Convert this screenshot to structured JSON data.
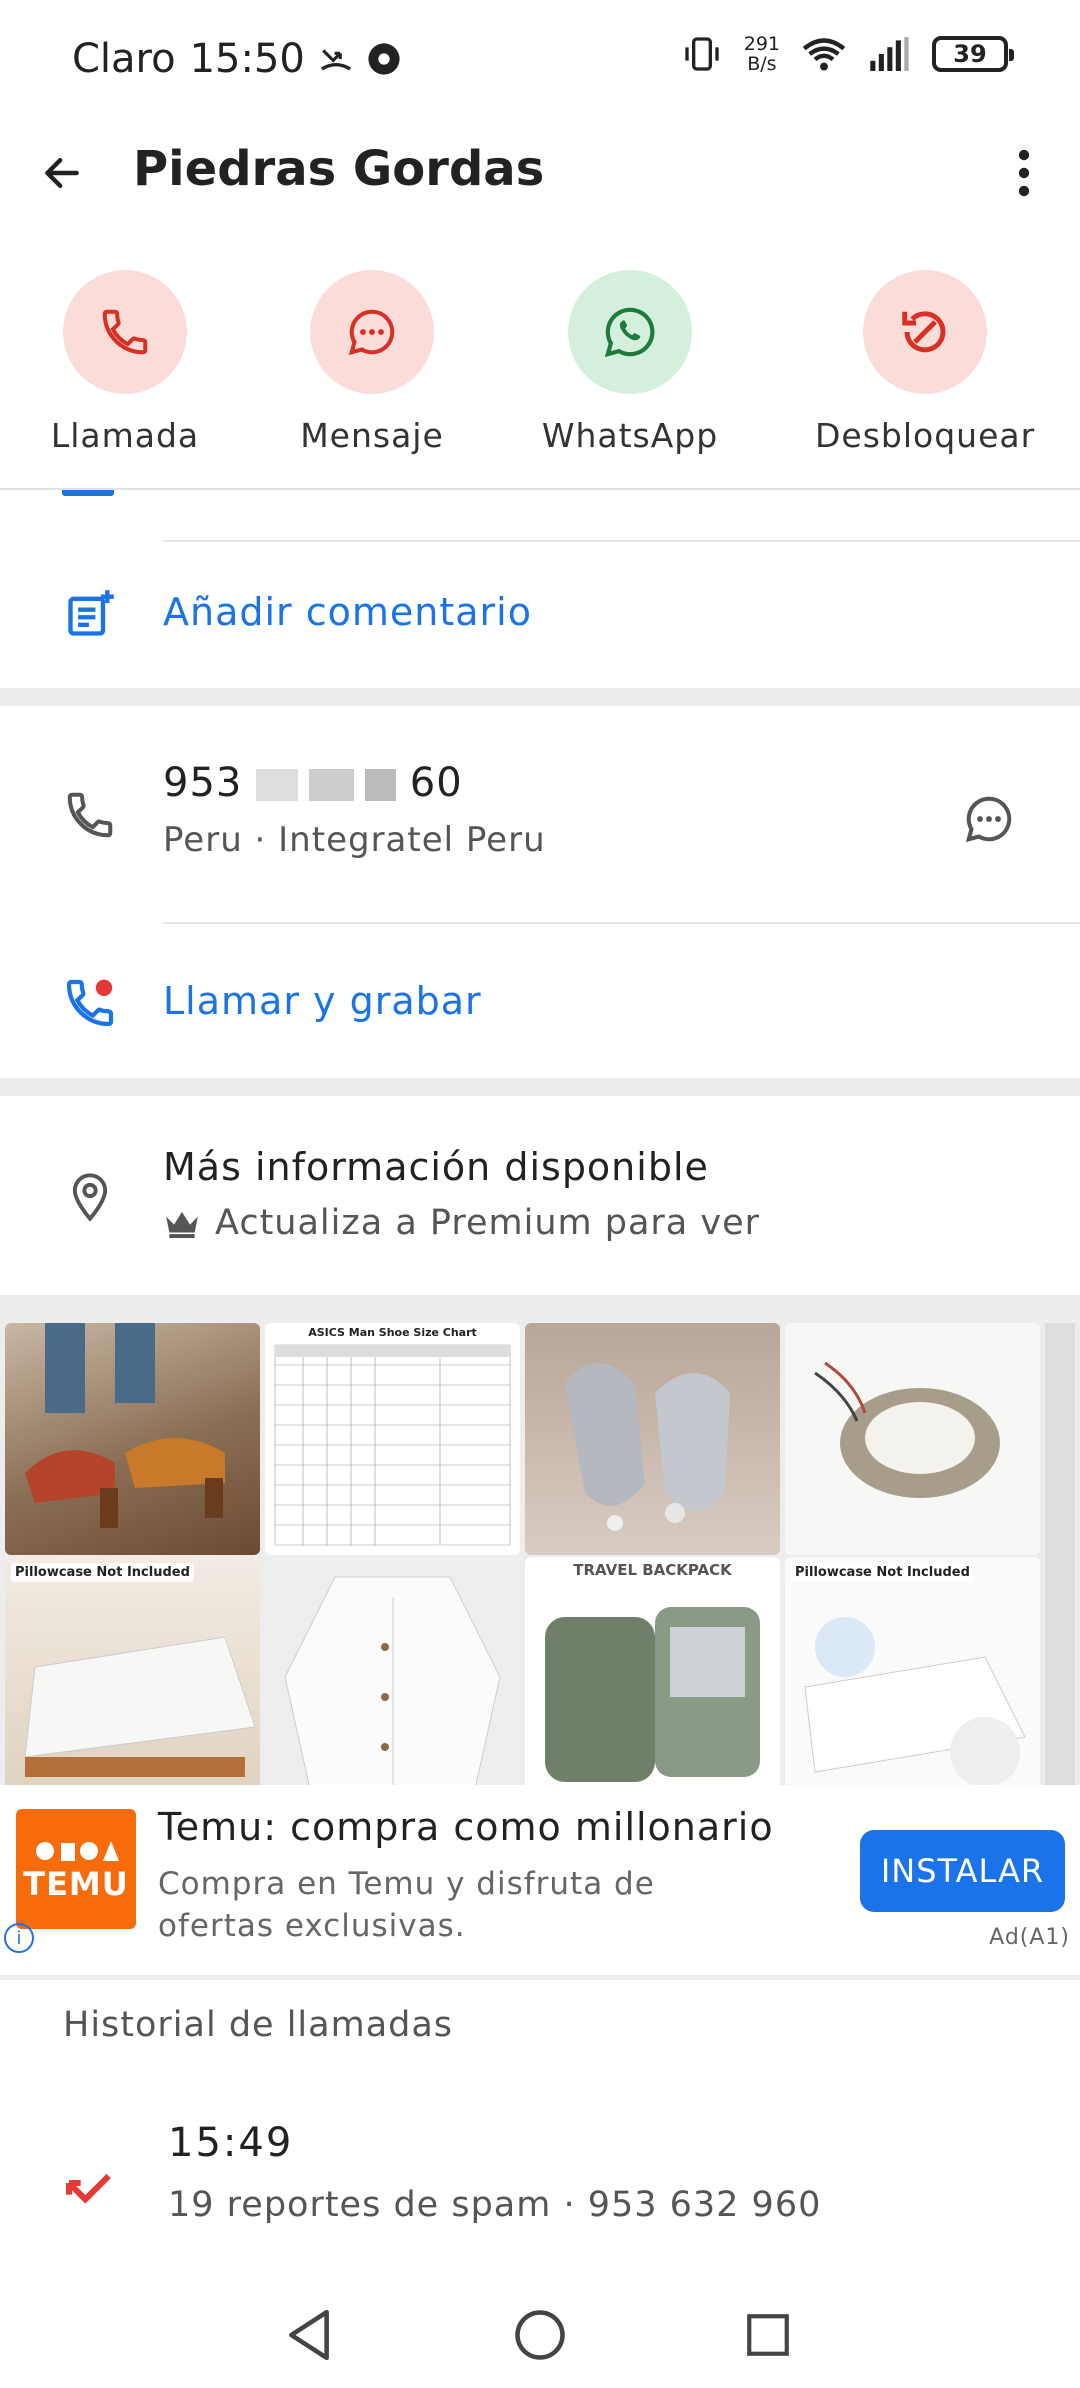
{
  "status_bar": {
    "carrier": "Claro",
    "time": "15:50",
    "net_speed_value": "291",
    "net_speed_unit": "B/s",
    "battery": "39"
  },
  "app_bar": {
    "title": "Piedras Gordas"
  },
  "actions": [
    {
      "label": "Llamada",
      "icon": "phone-icon",
      "bg": "#fadcd9",
      "fg": "#d93025"
    },
    {
      "label": "Mensaje",
      "icon": "message-icon",
      "bg": "#fadcd9",
      "fg": "#d93025"
    },
    {
      "label": "WhatsApp",
      "icon": "whatsapp-icon",
      "bg": "#d5efdd",
      "fg": "#1f7a3c"
    },
    {
      "label": "Desbloquear",
      "icon": "unblock-icon",
      "bg": "#fadcd9",
      "fg": "#d93025"
    }
  ],
  "comment": {
    "label": "Añadir comentario"
  },
  "phone": {
    "number_start": "953",
    "number_end": "60",
    "sub": "Peru · Integratel Peru"
  },
  "record": {
    "label": "Llamar y grabar"
  },
  "more_info": {
    "title": "Más información disponible",
    "sub": "Actualiza a Premium para ver"
  },
  "ad_images": [
    {
      "caption": "",
      "icon": "sandals-image"
    },
    {
      "caption": "ASICS Man Shoe Size Chart",
      "icon": "size-chart-image"
    },
    {
      "caption": "",
      "icon": "sneakers-image"
    },
    {
      "caption": "",
      "icon": "led-light-image"
    },
    {
      "caption": "Pillowcase Not Included",
      "icon": "mattress-cover-image"
    },
    {
      "caption": "",
      "icon": "white-jacket-image"
    },
    {
      "caption": "TRAVEL BACKPACK",
      "icon": "backpack-image"
    },
    {
      "caption": "Pillowcase Not Included",
      "icon": "mattress-protector-image"
    }
  ],
  "ad": {
    "brand": "TEMU",
    "title": "Temu: compra como millonario",
    "desc": "Compra en Temu y disfruta de ofertas exclusivas.",
    "install": "INSTALAR",
    "tag": "Ad(A1)",
    "accent": "#1a73e8"
  },
  "history": {
    "title": "Historial de llamadas",
    "time": "15:49",
    "sub": "19 reportes de spam · 953 632 960"
  }
}
